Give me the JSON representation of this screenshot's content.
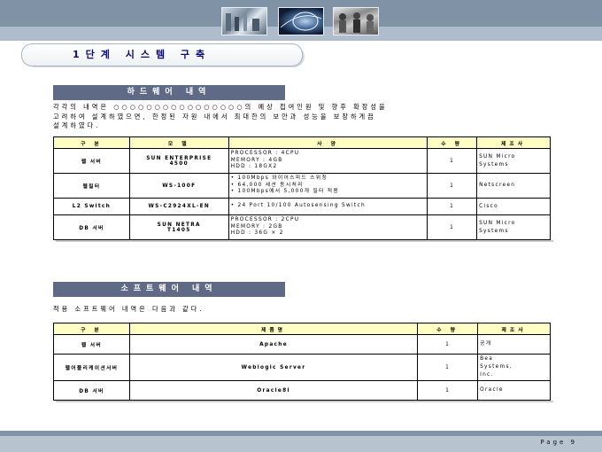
{
  "title": "1단계 시스템 구축",
  "hardware": {
    "heading": "하드웨어 내역",
    "paragraph_lines": [
      "각각의 내역은 ○○○○○○○○○○○○○○○○의 예상 접여인원 및 향후 확장성을",
      "고려하여 설계하였으면, 한정된 자원 내에서 최대한의 보안과 성능을 보장하게끔",
      "설계하였다."
    ],
    "columns": [
      "구 분",
      "모 델",
      "사 양",
      "수 량",
      "제조사"
    ],
    "rows": [
      {
        "category": "웹 서버",
        "model": [
          "SUN ENTERPRISE",
          "4500"
        ],
        "spec": [
          "PROCESSOR : 4CPU",
          "MEMORY : 4GB",
          "HDD : 18GX2"
        ],
        "qty": "1",
        "maker": [
          "SUN Micro",
          "Systems"
        ]
      },
      {
        "category": "웹필터",
        "model": [
          "WS-100F"
        ],
        "spec": [
          "• 100Mbps 와이어스피드 스위칭",
          "• 64,000 세션 동시처리",
          "• 100Mbps에서 5,000개 필터 적용"
        ],
        "qty": "1",
        "maker": [
          "Netscreen"
        ]
      },
      {
        "category": "L2 Switch",
        "model": [
          "WS-C2924XL-EN"
        ],
        "spec": [
          "• 24 Port 10/100 Autosensing Switch"
        ],
        "qty": "1",
        "maker": [
          "Cisco"
        ]
      },
      {
        "category": "DB 서버",
        "model": [
          "SUN NETRA",
          "T1405"
        ],
        "spec": [
          "PROCESSOR : 2CPU",
          "MEMORY : 2GB",
          "HDD : 36G × 2"
        ],
        "qty": "1",
        "maker": [
          "SUN Micro",
          "Systems"
        ]
      }
    ]
  },
  "software": {
    "heading": "소프트웨어 내역",
    "paragraph": "적용 소프트웨어 내역은 다음과 같다.",
    "columns": [
      "구 분",
      "제품명",
      "수 량",
      "제조사"
    ],
    "rows": [
      {
        "category": "웹 서버",
        "product": "Apache",
        "qty": "1",
        "maker": [
          "공개"
        ]
      },
      {
        "category": "웹어플리케이션서버",
        "product": "Weblogic Server",
        "qty": "1",
        "maker": [
          "Bea",
          "Systems,",
          "Inc."
        ]
      },
      {
        "category": "DB 서버",
        "product": "Oracle8i",
        "qty": "1",
        "maker": [
          "Oracle"
        ]
      }
    ]
  },
  "footer": {
    "page": "Page 9"
  }
}
